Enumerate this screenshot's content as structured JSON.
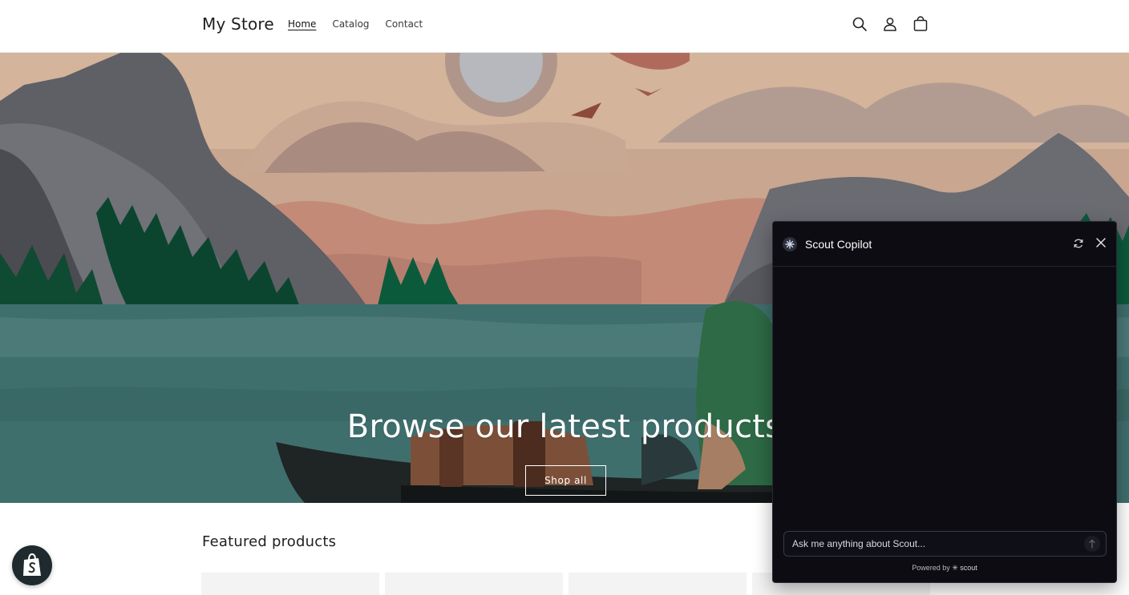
{
  "header": {
    "store_name": "My Store",
    "nav": [
      {
        "label": "Home",
        "active": true
      },
      {
        "label": "Catalog",
        "active": false
      },
      {
        "label": "Contact",
        "active": false
      }
    ],
    "icons": [
      "search-icon",
      "account-icon",
      "cart-icon"
    ]
  },
  "hero": {
    "title": "Browse our latest products",
    "button_label": "Shop all"
  },
  "featured": {
    "title": "Featured products"
  },
  "copilot": {
    "title": "Scout Copilot",
    "input_placeholder": "Ask me anything about Scout...",
    "powered_by_prefix": "Powered by",
    "powered_by_brand": "scout",
    "colors": {
      "background": "#0c0c12",
      "text": "#ffffff"
    }
  },
  "colors": {
    "water": "#3f6f6d",
    "sky": "#c9a68f",
    "mountain": "#6a6a70",
    "forest": "#0e4d35"
  }
}
